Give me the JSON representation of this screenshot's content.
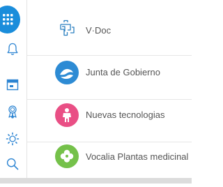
{
  "colors": {
    "accent": "#1a8ddb",
    "icon_blue": "#2c84d2",
    "vdoc_icon": "#2a7fc0",
    "junta": "#2d8bd4",
    "nuevas": "#e94f85",
    "vocalia": "#75c14a"
  },
  "sidebar": {
    "items": [
      {
        "icon": "grid-menu-icon"
      },
      {
        "icon": "bell-icon"
      },
      {
        "icon": "calendar-icon"
      },
      {
        "icon": "award-icon"
      },
      {
        "icon": "sun-icon"
      },
      {
        "icon": "search-icon"
      }
    ]
  },
  "list": {
    "items": [
      {
        "label": "V·Doc",
        "icon": "vdoc-icon"
      },
      {
        "label": "Junta de Gobierno",
        "icon": "wave-icon"
      },
      {
        "label": "Nuevas tecnologias",
        "icon": "figure-icon"
      },
      {
        "label": "Vocalia Plantas medicinal",
        "icon": "clover-icon"
      }
    ]
  }
}
